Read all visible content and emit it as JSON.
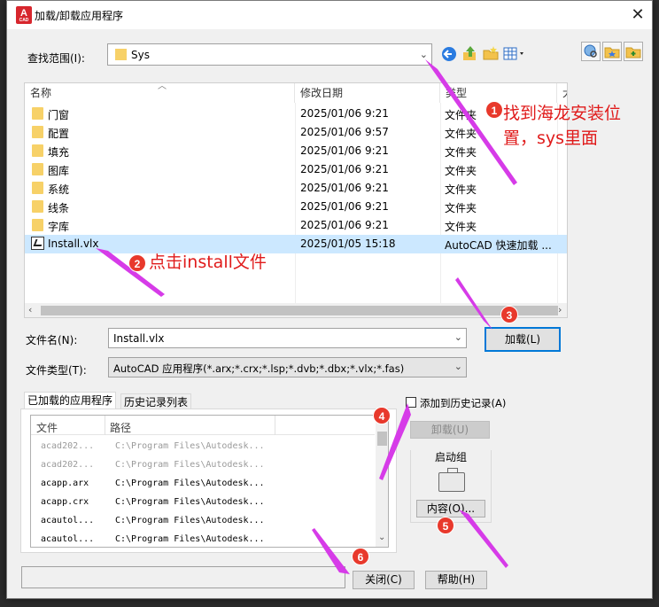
{
  "window": {
    "title": "加载/卸载应用程序",
    "app_icon": "A",
    "app_icon_sub": "CAD"
  },
  "lookin": {
    "label": "查找范围(I):",
    "value": "Sys"
  },
  "filelist": {
    "headers": [
      "名称",
      "修改日期",
      "类型",
      "大"
    ],
    "rows": [
      {
        "name": "门窗",
        "date": "2025/01/06 9:21",
        "type": "文件夹"
      },
      {
        "name": "配置",
        "date": "2025/01/06 9:57",
        "type": "文件夹"
      },
      {
        "name": "填充",
        "date": "2025/01/06 9:21",
        "type": "文件夹"
      },
      {
        "name": "图库",
        "date": "2025/01/06 9:21",
        "type": "文件夹"
      },
      {
        "name": "系统",
        "date": "2025/01/06 9:21",
        "type": "文件夹"
      },
      {
        "name": "线条",
        "date": "2025/01/06 9:21",
        "type": "文件夹"
      },
      {
        "name": "字库",
        "date": "2025/01/06 9:21",
        "type": "文件夹"
      },
      {
        "name": "Install.vlx",
        "date": "2025/01/05 15:18",
        "type": "AutoCAD 快速加载 ..."
      }
    ]
  },
  "filename": {
    "label": "文件名(N):",
    "value": "Install.vlx"
  },
  "filetype": {
    "label": "文件类型(T):",
    "value": "AutoCAD 应用程序(*.arx;*.crx;*.lsp;*.dvb;*.dbx;*.vlx;*.fas)"
  },
  "buttons": {
    "load": "加载(L)",
    "unload": "卸载(U)",
    "contents": "内容(O)...",
    "close": "关闭(C)",
    "help": "帮助(H)"
  },
  "tabs": {
    "loaded": "已加载的应用程序",
    "history": "历史记录列表"
  },
  "loaded": {
    "headers": [
      "文件",
      "路径"
    ],
    "rows": [
      {
        "file": "acad202...",
        "path": "C:\\Program Files\\Autodesk...",
        "muted": true
      },
      {
        "file": "acad202...",
        "path": "C:\\Program Files\\Autodesk...",
        "muted": true
      },
      {
        "file": "acapp.arx",
        "path": "C:\\Program Files\\Autodesk...",
        "muted": false
      },
      {
        "file": "acapp.crx",
        "path": "C:\\Program Files\\Autodesk...",
        "muted": false
      },
      {
        "file": "acautol...",
        "path": "C:\\Program Files\\Autodesk...",
        "muted": false
      },
      {
        "file": "acautol...",
        "path": "C:\\Program Files\\Autodesk...",
        "muted": false
      }
    ]
  },
  "add_history": "添加到历史记录(A)",
  "startup": {
    "title": "启动组"
  },
  "annotations": {
    "a1": "找到海龙安装位置，sys里面",
    "a2": "点击install文件",
    "badges": [
      "1",
      "2",
      "3",
      "4",
      "5",
      "6"
    ],
    "color": "#e01b1b",
    "arrow_color": "#d63be8"
  }
}
